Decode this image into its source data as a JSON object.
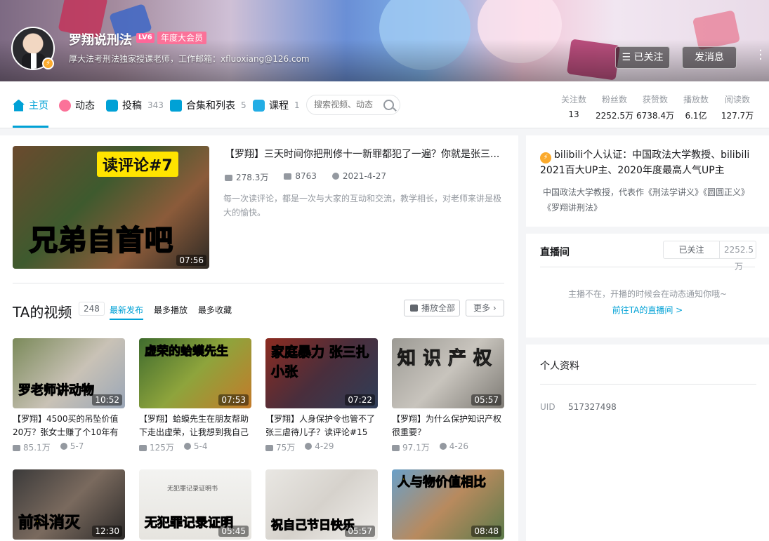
{
  "header": {
    "username": "罗翔说刑法",
    "level": "LV6",
    "vip_label": "年度大会员",
    "signature": "厚大法考刑法独家授课老师，工作邮箱：xfluoxiang@126.com",
    "followed_button": "已关注",
    "message_button": "发消息"
  },
  "nav": {
    "home": "主页",
    "dynamic": "动态",
    "posts": "投稿",
    "posts_count": "343",
    "collections": "合集和列表",
    "collections_count": "5",
    "courses": "课程",
    "courses_count": "1",
    "search_placeholder": "搜索视频、动态"
  },
  "stats": [
    {
      "label": "关注数",
      "value": "13"
    },
    {
      "label": "粉丝数",
      "value": "2252.5万"
    },
    {
      "label": "获赞数",
      "value": "6738.4万"
    },
    {
      "label": "播放数",
      "value": "6.1亿"
    },
    {
      "label": "阅读数",
      "value": "127.7万"
    }
  ],
  "featured": {
    "cover_tag": "读评论#7",
    "cover_text": "兄弟自首吧",
    "duration": "07:56",
    "title": "【罗翔】三天时间你把刑修十一新罪都犯了一遍？你就是张三...",
    "plays": "278.3万",
    "danmaku": "8763",
    "date": "2021-4-27",
    "desc": "每一次读评论，都是一次与大家的互动和交流，教学相长，对老师来讲是极大的愉快。"
  },
  "videos_section": {
    "title": "TA的视频",
    "count": "248",
    "tabs": [
      "最新发布",
      "最多播放",
      "最多收藏"
    ],
    "play_all": "播放全部",
    "more": "更多"
  },
  "videos": [
    {
      "cap": "罗老师讲动物",
      "duration": "10:52",
      "title": "【罗翔】4500买的吊坠价值20万？张女士赚了个10年有",
      "plays": "85.1万",
      "date": "5-7"
    },
    {
      "cap": "虚荣的蛤蟆先生",
      "duration": "07:53",
      "title": "【罗翔】蛤蟆先生在朋友帮助下走出虚荣，让我想到我自己",
      "plays": "125万",
      "date": "5-4"
    },
    {
      "cap": "家庭暴力 张三扎小张",
      "duration": "07:22",
      "title": "【罗翔】人身保护令也管不了张三虐待儿子？读评论#15",
      "plays": "75万",
      "date": "4-29"
    },
    {
      "cap": "知识产权",
      "duration": "05:57",
      "title": "【罗翔】为什么保护知识产权很重要？",
      "plays": "97.1万",
      "date": "4-26"
    },
    {
      "cap": "前科消灭",
      "duration": "12:30"
    },
    {
      "cap": "无犯罪记录证明",
      "duration": "05:45",
      "doc": "无犯罪记录证明书"
    },
    {
      "cap": "祝自己节日快乐",
      "duration": "05:57"
    },
    {
      "cap": "人与物价值相比",
      "duration": "08:48"
    }
  ],
  "auth": {
    "headline": "bilibili个人认证：中国政法大学教授、bilibili 2021百大UP主、2020年度最高人气UP主",
    "body": "中国政法大学教授，代表作《刑法学讲义》《圆圆正义》《罗翔讲刑法》"
  },
  "live": {
    "title": "直播间",
    "followed": "已关注",
    "fans": "2252.5万",
    "empty": "主播不在，开播的时候会在动态通知你哦~",
    "go": "前往TA的直播间 >"
  },
  "profile": {
    "title": "个人资料",
    "uid_label": "UID",
    "uid": "517327498"
  }
}
